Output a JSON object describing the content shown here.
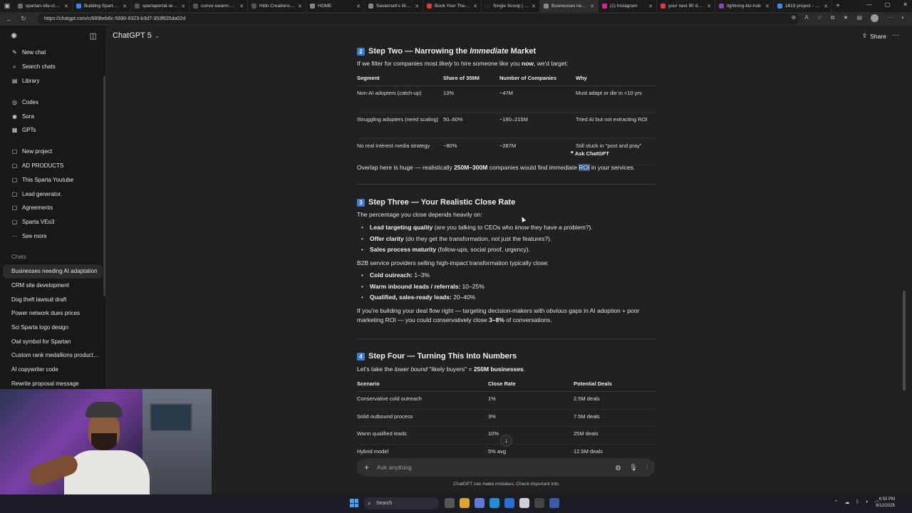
{
  "browser": {
    "tabs": [
      {
        "label": "spartan-site-cloner",
        "color": "#6e6e6e"
      },
      {
        "label": "Building Sparta Cl…",
        "color": "#3b82f6"
      },
      {
        "label": "spartaportal-remat…",
        "color": "#555555"
      },
      {
        "label": "convo-swarm-clone…",
        "color": "#555555"
      },
      {
        "label": "Hidn Creations Lea…",
        "color": "#555555"
      },
      {
        "label": "HOME",
        "color": "#888888"
      },
      {
        "label": "Savannah's World",
        "color": "#888888"
      },
      {
        "label": "Book Your The Gre…",
        "color": "#e53935"
      },
      {
        "label": "Single Scoop | Loo…",
        "color": "#222222"
      },
      {
        "label": "Businesses needin…",
        "color": "#888888",
        "active": true
      },
      {
        "label": "(1) Instagram",
        "color": "#d6249f"
      },
      {
        "label": "your next 90 days…",
        "color": "#e53935"
      },
      {
        "label": "lightning-biz-hub",
        "color": "#8e44ad"
      },
      {
        "label": "1619 project - Goo…",
        "color": "#4285f4"
      }
    ],
    "url": "https://chatgpt.com/c/689beb6c-5690-8323-b3d7-353f835da02d"
  },
  "sidebar": {
    "nav": [
      {
        "label": "New chat",
        "icon": "✎"
      },
      {
        "label": "Search chats",
        "icon": "⌕"
      },
      {
        "label": "Library",
        "icon": "▤"
      }
    ],
    "apps": [
      {
        "label": "Codex",
        "icon": "◎"
      },
      {
        "label": "Sora",
        "icon": "◉"
      },
      {
        "label": "GPTs",
        "icon": "▦"
      }
    ],
    "projects": [
      {
        "label": "New project",
        "icon": "▢"
      },
      {
        "label": "AD PRODUCTS",
        "icon": "▢"
      },
      {
        "label": "This Sparta Youtube",
        "icon": "▢"
      },
      {
        "label": "Lead generator.",
        "icon": "▢"
      },
      {
        "label": "Agreements",
        "icon": "▢"
      },
      {
        "label": "Sparta VEo3",
        "icon": "▢"
      },
      {
        "label": "See more",
        "icon": "···"
      }
    ],
    "chats_heading": "Chats",
    "chats": [
      "Businesses needing AI adaptation",
      "CRM site development",
      "Dog theft lawsuit draft",
      "Power network dues prices",
      "Sci Sparta logo design",
      "Owl symbol for Spartan",
      "Custom rank medallions product…",
      "AI copywriter code",
      "Rewrite proposal message"
    ]
  },
  "header": {
    "model": "ChatGPT 5",
    "share": "Share"
  },
  "content": {
    "step2": {
      "num": "2",
      "title_a": "Step Two — Narrowing the ",
      "title_em": "Immediate",
      "title_b": " Market",
      "intro_a": "If we filter for companies most ",
      "intro_em": "likely",
      "intro_b": " to hire someone like you ",
      "intro_bold": "now",
      "intro_c": ", we'd target:",
      "headers": [
        "Segment",
        "Share of 359M",
        "Number of Companies",
        "Why"
      ],
      "rows": [
        [
          "Non-AI adopters (catch-up)",
          "13%",
          "~47M",
          "Must adapt or die in <10 yrs"
        ],
        [
          "Struggling adopters (need scaling)",
          "50–60%",
          "~180–215M",
          "Tried AI but not extracting ROI"
        ],
        [
          "No real interest media strategy",
          "~80%",
          "~287M",
          "Still stuck in \"post and pray\" mode"
        ]
      ],
      "overlap_a": "Overlap here is huge — realistically ",
      "overlap_bold": "250M–300M",
      "overlap_b": " companies would find immediate ",
      "overlap_hl": "ROI",
      "overlap_c": " in your services.",
      "ask_popup": "Ask ChatGPT"
    },
    "step3": {
      "num": "3",
      "title": "Step Three — Your Realistic Close Rate",
      "intro": "The percentage you close depends heavily on:",
      "factors": [
        {
          "bold": "Lead targeting quality",
          "a": " (are you talking to CEOs who ",
          "em": "know",
          "b": " they have a problem?)."
        },
        {
          "bold": "Offer clarity",
          "a": " (do they get the transformation, not just the features?).",
          "em": "",
          "b": ""
        },
        {
          "bold": "Sales process maturity",
          "a": " (follow-ups, social proof, urgency).",
          "em": "",
          "b": ""
        }
      ],
      "b2b": "B2B service providers selling high-impact transformation typically close:",
      "rates": [
        {
          "bold": "Cold outreach:",
          "text": " 1–3%"
        },
        {
          "bold": "Warm inbound leads / referrals:",
          "text": " 10–25%"
        },
        {
          "bold": "Qualified, sales-ready leads:",
          "text": " 20–40%"
        }
      ],
      "conclusion_a": "If you're building your deal flow right — targeting decision-makers with ",
      "conclusion_em": "obvious",
      "conclusion_b": " gaps in AI adoption + poor marketing ROI — you could conservatively close ",
      "conclusion_bold": "3–8%",
      "conclusion_c": " of conversations."
    },
    "step4": {
      "num": "4",
      "title": "Step Four — Turning This Into Numbers",
      "intro_a": "Let's take the ",
      "intro_em": "lower bound",
      "intro_b": " \"likely buyers\" = ",
      "intro_bold": "250M businesses",
      "intro_c": ".",
      "headers": [
        "Scenario",
        "Close Rate",
        "Potential Deals"
      ],
      "rows": [
        [
          "Conservative cold outreach",
          "1%",
          "2.5M deals"
        ],
        [
          "Solid outbound process",
          "3%",
          "7.5M deals"
        ],
        [
          "Warm qualified leads",
          "10%",
          "25M deals"
        ],
        [
          "Hybrid model",
          "5% avg",
          "12.5M deals"
        ]
      ]
    }
  },
  "composer": {
    "placeholder": "Ask anything",
    "disclaimer": "ChatGPT can make mistakes. Check important info."
  },
  "taskbar": {
    "search": "Search",
    "time": "6:50 PM",
    "date": "8/12/2025"
  }
}
